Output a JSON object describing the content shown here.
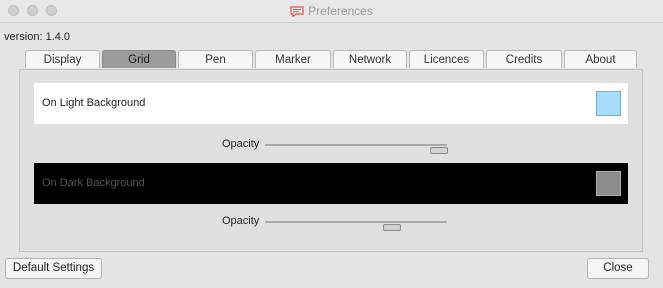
{
  "window": {
    "title": "Preferences",
    "app_icon": "chat-bubble-icon"
  },
  "version_text": "version: 1.4.0",
  "tabs": [
    {
      "label": "Display",
      "active": false
    },
    {
      "label": "Grid",
      "active": true
    },
    {
      "label": "Pen",
      "active": false
    },
    {
      "label": "Marker",
      "active": false
    },
    {
      "label": "Network",
      "active": false
    },
    {
      "label": "Licences",
      "active": false
    },
    {
      "label": "Credits",
      "active": false
    },
    {
      "label": "About",
      "active": false
    }
  ],
  "grid": {
    "light": {
      "label": "On Light Background",
      "swatch_color": "#a7dcfb",
      "opacity_label": "Opacity",
      "opacity_value": 0.95
    },
    "dark": {
      "label": "On Dark Background",
      "swatch_color": "#8c8c8c",
      "opacity_label": "Opacity",
      "opacity_value": 0.69
    }
  },
  "buttons": {
    "default_settings": "Default Settings",
    "close": "Close"
  },
  "colors": {
    "active_tab": "#9c9c9c",
    "light_swatch": "#a7dcfb",
    "dark_swatch": "#8c8c8c"
  }
}
